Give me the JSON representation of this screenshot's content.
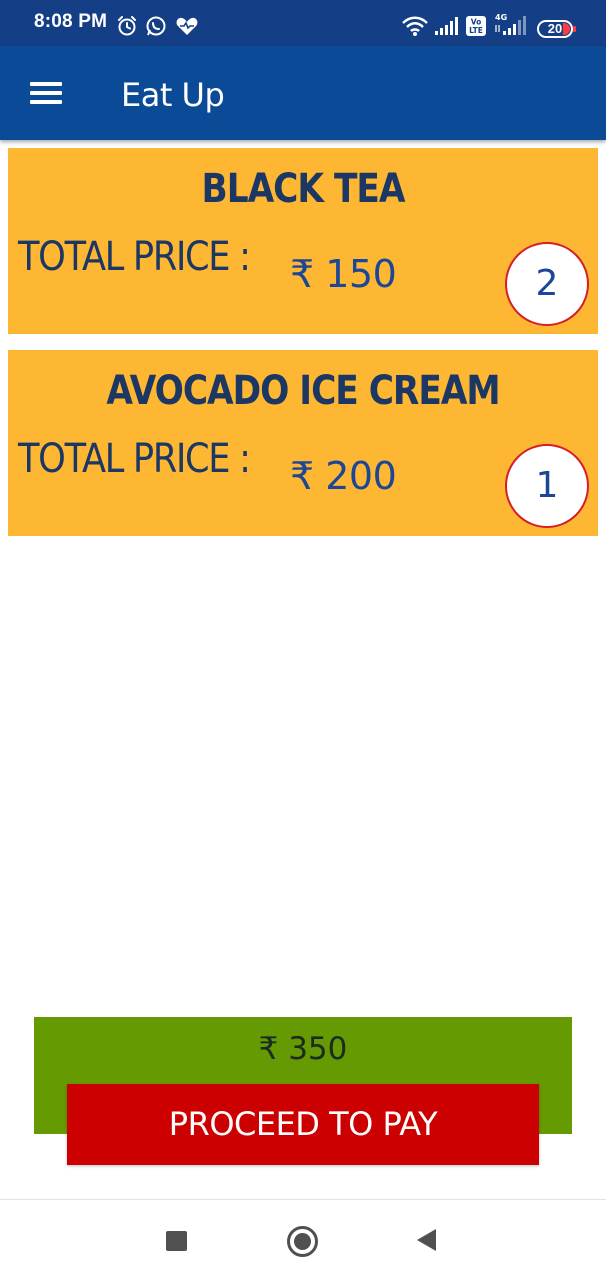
{
  "status_bar": {
    "time": "8:08 PM",
    "battery": "20",
    "left_icons": [
      "alarm-icon",
      "whatsapp-icon",
      "heart-icon"
    ],
    "right_icons": [
      "wifi-icon",
      "signal-icon",
      "volte-icon",
      "4g-signal-icon",
      "battery-icon"
    ]
  },
  "app_bar": {
    "title": "Eat Up",
    "menu_icon": "menu-icon"
  },
  "cart": {
    "items": [
      {
        "name": "BLACK TEA",
        "price_label": "TOTAL PRICE :",
        "price": "₹ 150",
        "quantity": "2"
      },
      {
        "name": "AVOCADO ICE CREAM",
        "price_label": "TOTAL PRICE :",
        "price": "₹ 200",
        "quantity": "1"
      }
    ]
  },
  "footer": {
    "total": "₹ 350",
    "pay_button_label": "PROCEED TO PAY"
  },
  "nav_bar": {
    "buttons": [
      "recents-icon",
      "home-icon",
      "back-icon"
    ]
  },
  "colors": {
    "status_bar": "#143f86",
    "app_bar": "#0a4a97",
    "card": "#fdb733",
    "total_bar": "#669a02",
    "pay_button": "#cc0000",
    "badge_border": "#d41f27"
  }
}
